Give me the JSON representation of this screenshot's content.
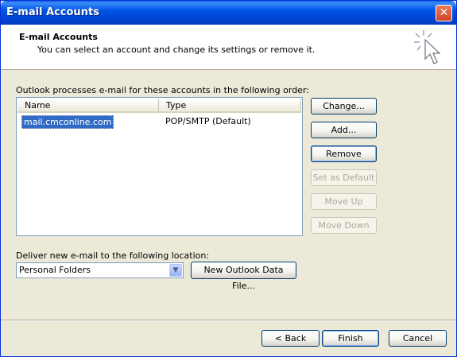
{
  "window": {
    "title": "E-mail Accounts",
    "close_glyph": "✕"
  },
  "header": {
    "title": "E-mail Accounts",
    "subtitle": "You can select an account and change its settings or remove it.",
    "icon": "cursor-sparkle-icon"
  },
  "accounts": {
    "label": "Outlook processes e-mail for these accounts in the following order:",
    "columns": [
      "Name",
      "Type"
    ],
    "rows": [
      {
        "name": "mail.cmconline.com",
        "type": "POP/SMTP (Default)",
        "selected": true
      }
    ]
  },
  "side_buttons": {
    "change": "Change...",
    "add": "Add...",
    "remove": "Remove",
    "set_default": "Set as Default",
    "move_up": "Move Up",
    "move_down": "Move Down"
  },
  "delivery": {
    "label": "Deliver new e-mail to the following location:",
    "selected": "Personal Folders",
    "new_file_button": "New Outlook Data File..."
  },
  "footer": {
    "back": "< Back",
    "finish": "Finish",
    "cancel": "Cancel"
  },
  "colors": {
    "titlebar": "#0055e5",
    "dialog_bg": "#ece9d8",
    "selection": "#316ac5"
  }
}
